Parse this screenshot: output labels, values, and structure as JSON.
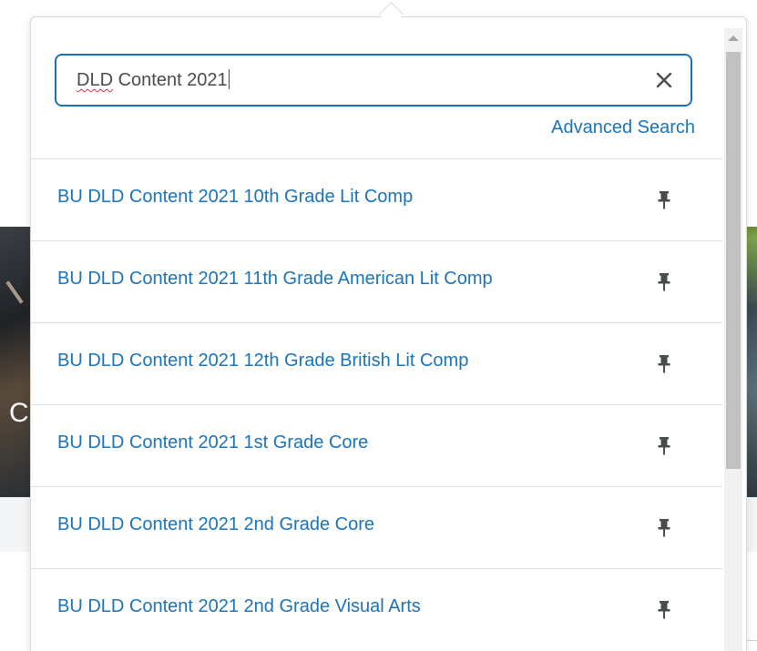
{
  "search": {
    "query_spellflag": "DLD",
    "query_rest": " Content 2021",
    "clear_icon": "close-icon",
    "advanced_link": "Advanced Search"
  },
  "results": [
    {
      "label": "BU DLD Content 2021 10th Grade Lit Comp",
      "icon": "pin-icon"
    },
    {
      "label": "BU DLD Content 2021 11th Grade American Lit Comp",
      "icon": "pin-icon"
    },
    {
      "label": "BU DLD Content 2021 12th Grade British Lit Comp",
      "icon": "pin-icon"
    },
    {
      "label": "BU DLD Content 2021 1st Grade Core",
      "icon": "pin-icon"
    },
    {
      "label": "BU DLD Content 2021 2nd Grade Core",
      "icon": "pin-icon"
    },
    {
      "label": "BU DLD Content 2021 2nd Grade Visual Arts",
      "icon": "pin-icon"
    }
  ],
  "background": {
    "partial_glyph": "C"
  },
  "colors": {
    "link": "#1a73b8",
    "border_focus": "#1a73b8",
    "text": "#494c4e",
    "divider": "#dcdfe1"
  }
}
